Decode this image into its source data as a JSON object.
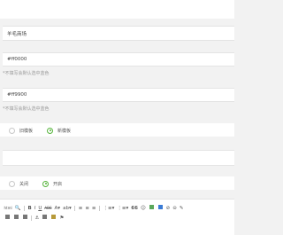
{
  "form": {
    "name_value": "羊毛商场",
    "color1": {
      "value": "#ff0000",
      "hint": "*不填写会默认选中蓝色"
    },
    "color2": {
      "value": "#ff9900",
      "hint": "*不填写会默认选中蓝色"
    },
    "template_radio": {
      "options": [
        "旧模板",
        "新模板"
      ],
      "selected": "新模板"
    },
    "switch_radio": {
      "options": [
        "关闭",
        "开启"
      ],
      "selected": "开启"
    }
  },
  "editor_toolbar": {
    "row1": [
      "html",
      "search-icon",
      "B",
      "I",
      "U",
      "ABC",
      "A",
      "ab",
      "align-left",
      "align-center",
      "align-right",
      "list-ordered",
      "list-unordered",
      "66",
      "emoji",
      "image",
      "video",
      "link",
      "unlink",
      "brush"
    ],
    "row2": [
      "table-icon",
      "table-row-icon",
      "table-col-icon",
      "anchor-icon",
      "pagebreak-icon",
      "image-icon",
      "flag-icon"
    ]
  },
  "colors": {
    "accent_green": "#56b43b",
    "hint_gray": "#999999"
  }
}
